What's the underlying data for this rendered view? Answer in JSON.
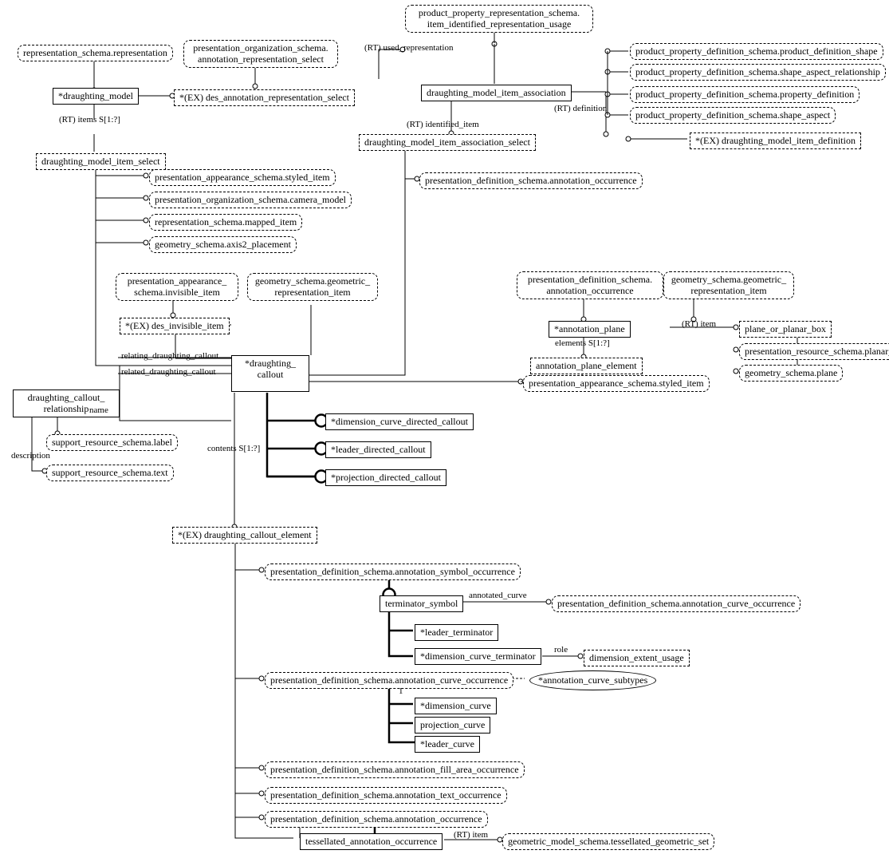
{
  "n": {
    "rep_schema_rep": "representation_schema.representation",
    "pres_org_annot_sel": "presentation_organization_schema.\nannotation_representation_select",
    "ppr_item_ident": "product_property_representation_schema.\nitem_identified_representation_usage",
    "ppd_shape": "product_property_definition_schema.product_definition_shape",
    "ppd_sar": "product_property_definition_schema.shape_aspect_relationship",
    "ppd_pd": "product_property_definition_schema.property_definition",
    "ppd_sa": "product_property_definition_schema.shape_aspect",
    "draughting_model": "*draughting_model",
    "des_annot_sel": "*(EX) des_annotation_representation_select",
    "draughting_model_item_assoc": "draughting_model_item_association",
    "draughting_model_item_def": "*(EX) draughting_model_item_definition",
    "draughting_model_item_sel": "draughting_model_item_select",
    "draughting_model_item_assoc_sel": "draughting_model_item_association_select",
    "pas_styled_item": "presentation_appearance_schema.styled_item",
    "pos_camera": "presentation_organization_schema.camera_model",
    "rs_mapped": "representation_schema.mapped_item",
    "gs_axis2": "geometry_schema.axis2_placement",
    "pas_invisible": "presentation_appearance_\nschema.invisible_item",
    "gs_geom_rep_item": "geometry_schema.geometric_\nrepresentation_item",
    "des_invisible": "*(EX) des_invisible_item",
    "draughting_callout": "*draughting_\ncallout",
    "pds_annot_occ_mid": "presentation_definition_schema.annotation_occurrence",
    "pds_annot_occ_top": "presentation_definition_schema.\nannotation_occurrence",
    "gs_geom_rep_item2": "geometry_schema.geometric_\nrepresentation_item",
    "annotation_plane": "*annotation_plane",
    "plane_or_box": "plane_or_planar_box",
    "prs_planar_box": "presentation_resource_schema.planar_box",
    "gs_plane": "geometry_schema.plane",
    "annot_plane_element": "annotation_plane_element",
    "pas_styled_item2": "presentation_appearance_schema.styled_item",
    "dc_rel": "draughting_callout_\nrelationship",
    "srs_label": "support_resource_schema.label",
    "srs_text": "support_resource_schema.text",
    "dim_curve_callout": "*dimension_curve_directed_callout",
    "leader_callout": "*leader_directed_callout",
    "proj_callout": "*projection_directed_callout",
    "dc_element": "*(EX) draughting_callout_element",
    "pds_annot_sym": "presentation_definition_schema.annotation_symbol_occurrence",
    "terminator_symbol": "terminator_symbol",
    "pds_annot_curve_occ": "presentation_definition_schema.annotation_curve_occurrence",
    "leader_terminator": "*leader_terminator",
    "dim_curve_terminator": "*dimension_curve_terminator",
    "dim_extent_usage": "dimension_extent_usage",
    "pds_annot_curve_occ2": "presentation_definition_schema.annotation_curve_occurrence",
    "annot_curve_subtypes": "*annotation_curve_subtypes",
    "dimension_curve": "*dimension_curve",
    "projection_curve": "projection_curve",
    "leader_curve": "*leader_curve",
    "pds_fill_area": "presentation_definition_schema.annotation_fill_area_occurrence",
    "pds_text_occ": "presentation_definition_schema.annotation_text_occurrence",
    "pds_annot_occ3": "presentation_definition_schema.annotation_occurrence",
    "tess_annot": "tessellated_annotation_occurrence",
    "gms_tess": "geometric_model_schema.tessellated_geometric_set"
  },
  "l": {
    "used_rep": "(RT) used_representation",
    "definition": "(RT) definition",
    "identified_item": "(RT) identified_item",
    "items": "(RT) items S[1:?]",
    "relating_dc": "relating_draughting_callout",
    "related_dc": "related_draughting_callout",
    "name": "name",
    "description": "description",
    "contents": "contents S[1:?]",
    "elements": "elements S[1:?]",
    "rt_item": "(RT) item",
    "rt_item2": "(RT) item",
    "annotated_curve": "annotated_curve",
    "role": "role",
    "one": "1"
  }
}
